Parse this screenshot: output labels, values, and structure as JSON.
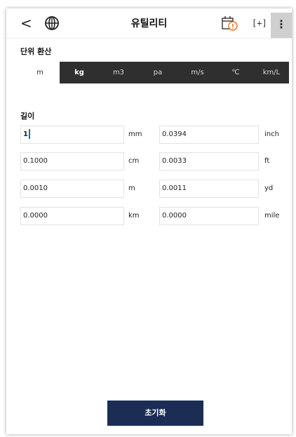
{
  "header": {
    "title": "유틸리티",
    "back_icon": "<",
    "fullscreen_icon": "[+]",
    "more_icon": "⋮"
  },
  "conversion": {
    "title": "단위 환산",
    "tabs": [
      {
        "label": "m",
        "active": true
      },
      {
        "label": "kg",
        "active": false
      },
      {
        "label": "m3",
        "active": false
      },
      {
        "label": "pa",
        "active": false
      },
      {
        "label": "m/s",
        "active": false
      },
      {
        "label": "℃",
        "active": false
      },
      {
        "label": "km/L",
        "active": false
      }
    ]
  },
  "length": {
    "title": "길이",
    "rows": [
      {
        "left_value": "1",
        "left_unit": "mm",
        "right_value": "0.0394",
        "right_unit": "inch"
      },
      {
        "left_value": "0.1000",
        "left_unit": "cm",
        "right_value": "0.0033",
        "right_unit": "ft"
      },
      {
        "left_value": "0.0010",
        "left_unit": "m",
        "right_value": "0.0011",
        "right_unit": "yd"
      },
      {
        "left_value": "0.0000",
        "left_unit": "km",
        "right_value": "0.0000",
        "right_unit": "mile"
      }
    ]
  },
  "footer": {
    "reset_label": "초기화"
  },
  "colors": {
    "tab_bar": "#2f2f2f",
    "reset_button": "#1b2d55",
    "more_button_bg": "#cfcfcf",
    "notification_badge": "#e8731f"
  },
  "icons": {
    "back": "chevron-left-icon",
    "globe": "globe-icon",
    "calendar": "calendar-alert-icon",
    "fullscreen": "fullscreen-icon",
    "more": "more-vertical-icon"
  }
}
